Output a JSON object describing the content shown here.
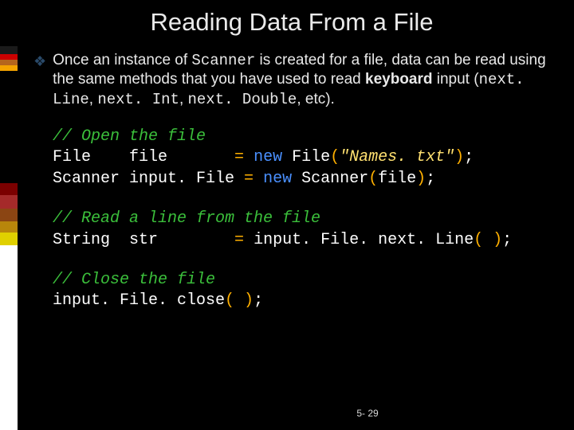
{
  "title": "Reading Data From a File",
  "bullet": {
    "p1": "Once an instance of ",
    "p2": "Scanner",
    "p3": " is created for a file, data can be read using the same methods that you have used to read ",
    "p4": "keyboard",
    "p5": " input (",
    "p6": "next. Line",
    "p7": ", ",
    "p8": "next. Int",
    "p9": ", ",
    "p10": "next. Double",
    "p11": ", etc)."
  },
  "code": {
    "c1": "// Open the file",
    "l2a": "File    file       ",
    "l2b": "=",
    "l2c": " ",
    "l2d": "new",
    "l2e": " File",
    "l2f": "(",
    "l2g": "\"Names. txt\"",
    "l2h": ")",
    "l2i": ";",
    "l3a": "Scanner input. File ",
    "l3b": "=",
    "l3c": " ",
    "l3d": "new",
    "l3e": " Scanner",
    "l3f": "(",
    "l3g": "file",
    "l3h": ")",
    "l3i": ";",
    "c2": "// Read a line from the file",
    "l4a": "String  str        ",
    "l4b": "=",
    "l4c": " input. File. next. Line",
    "l4d": "( )",
    "l4e": ";",
    "c3": "// Close the file",
    "l5a": "input. File. close",
    "l5b": "( )",
    "l5c": ";"
  },
  "page_num": "5- 29"
}
